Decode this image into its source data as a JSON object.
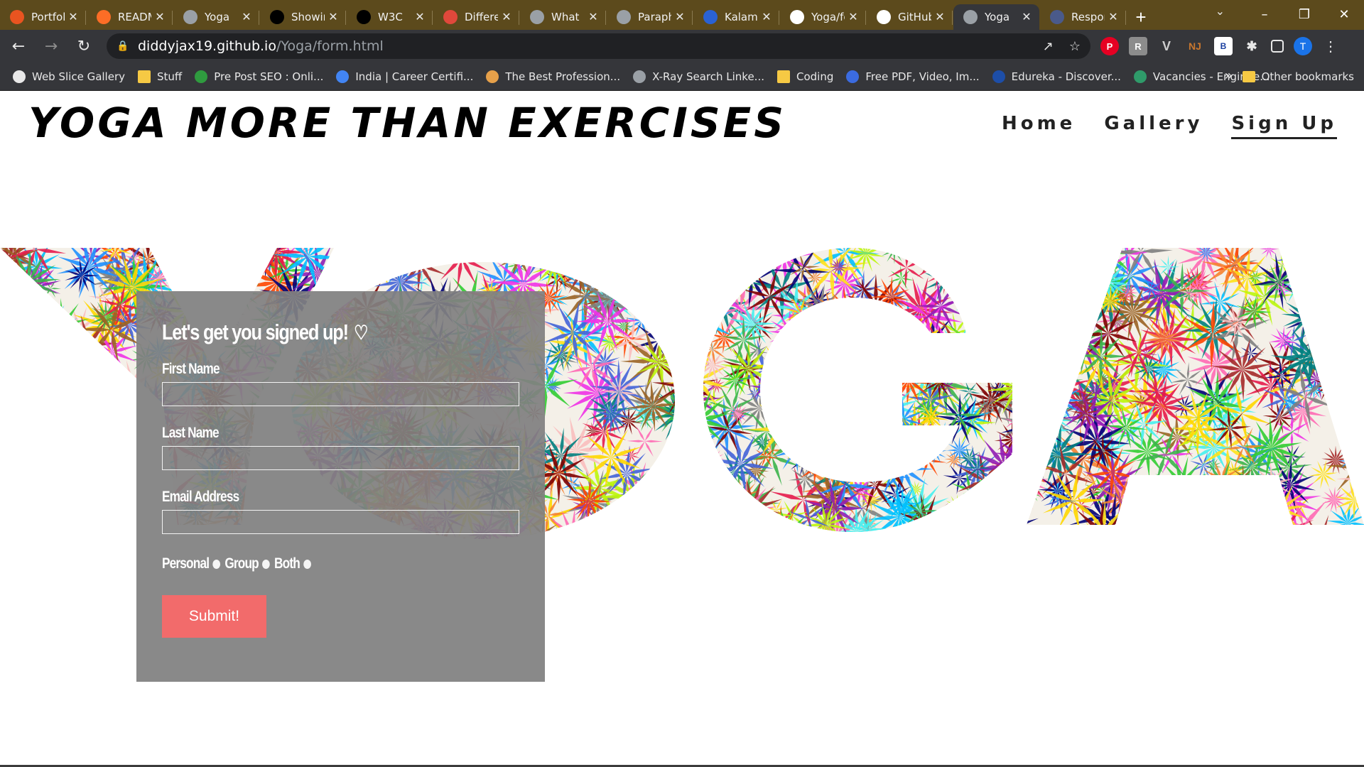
{
  "browser": {
    "tabs": [
      {
        "title": "Portfolio",
        "icon": "ubuntu-icon",
        "color": "#e95420"
      },
      {
        "title": "README",
        "icon": "gitlab-icon",
        "color": "#fc6d26"
      },
      {
        "title": "Yoga",
        "icon": "globe-icon",
        "color": "#9aa0a6"
      },
      {
        "title": "Showing",
        "icon": "nu-icon",
        "color": "#000000"
      },
      {
        "title": "W3C",
        "icon": "w3c-icon",
        "color": "#000000"
      },
      {
        "title": "Differences",
        "icon": "differ-icon",
        "color": "#e0483b"
      },
      {
        "title": "What",
        "icon": "openai-icon",
        "color": "#9aa0a6"
      },
      {
        "title": "Paraphraser",
        "icon": "quill-icon",
        "color": "#9aa0a6"
      },
      {
        "title": "Kalam",
        "icon": "kalam-icon",
        "color": "#2a62d4"
      },
      {
        "title": "Yoga/form",
        "icon": "github-icon",
        "color": "#ffffff"
      },
      {
        "title": "GitHub",
        "icon": "github-icon",
        "color": "#ffffff"
      },
      {
        "title": "Yoga",
        "icon": "globe-icon",
        "color": "#9aa0a6",
        "active": true
      },
      {
        "title": "Responsive",
        "icon": "r-icon",
        "color": "#4a5a8a"
      }
    ],
    "url_host": "diddyjax19.github.io",
    "url_path": "/Yoga/form.html",
    "profile_initial": "T",
    "bookmarks": [
      {
        "label": "Web Slice Gallery",
        "color": "#e8e8e8"
      },
      {
        "label": "Stuff",
        "color": "#f6c944",
        "folder": true
      },
      {
        "label": "Pre Post SEO : Onli...",
        "color": "#2f9b3f"
      },
      {
        "label": "India | Career Certifi...",
        "color": "#4285f4"
      },
      {
        "label": "The Best Profession...",
        "color": "#e6a04a"
      },
      {
        "label": "X-Ray Search Linke...",
        "color": "#9aa0a6"
      },
      {
        "label": "Coding",
        "color": "#f6c944",
        "folder": true
      },
      {
        "label": "Free PDF, Video, Im...",
        "color": "#3b6be0"
      },
      {
        "label": "Edureka - Discover...",
        "color": "#1d4ea8"
      },
      {
        "label": "Vacancies - Enginee...",
        "color": "#2f9b6a"
      }
    ],
    "bookmarks_overflow": "»",
    "other_bookmarks": "Other bookmarks"
  },
  "site": {
    "title": "YOGA MORE THAN EXERCISES",
    "nav": [
      "Home",
      "Gallery",
      "Sign Up"
    ],
    "hero_word": "YOGA"
  },
  "form": {
    "heading": "Let's get you signed up!",
    "first_name_label": "First Name",
    "last_name_label": "Last Name",
    "email_label": "Email Address",
    "options": [
      "Personal",
      "Group",
      "Both"
    ],
    "submit_label": "Submit!",
    "submit_color": "#f26b6b"
  }
}
